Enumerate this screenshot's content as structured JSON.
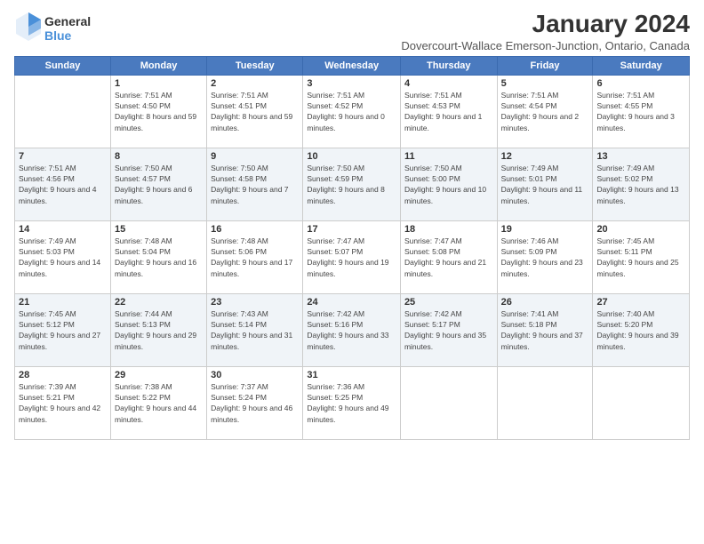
{
  "logo": {
    "text_general": "General",
    "text_blue": "Blue"
  },
  "title": "January 2024",
  "subtitle": "Dovercourt-Wallace Emerson-Junction, Ontario, Canada",
  "days_of_week": [
    "Sunday",
    "Monday",
    "Tuesday",
    "Wednesday",
    "Thursday",
    "Friday",
    "Saturday"
  ],
  "weeks": [
    [
      {
        "day": "",
        "sunrise": "",
        "sunset": "",
        "daylight": ""
      },
      {
        "day": "1",
        "sunrise": "Sunrise: 7:51 AM",
        "sunset": "Sunset: 4:50 PM",
        "daylight": "Daylight: 8 hours and 59 minutes."
      },
      {
        "day": "2",
        "sunrise": "Sunrise: 7:51 AM",
        "sunset": "Sunset: 4:51 PM",
        "daylight": "Daylight: 8 hours and 59 minutes."
      },
      {
        "day": "3",
        "sunrise": "Sunrise: 7:51 AM",
        "sunset": "Sunset: 4:52 PM",
        "daylight": "Daylight: 9 hours and 0 minutes."
      },
      {
        "day": "4",
        "sunrise": "Sunrise: 7:51 AM",
        "sunset": "Sunset: 4:53 PM",
        "daylight": "Daylight: 9 hours and 1 minute."
      },
      {
        "day": "5",
        "sunrise": "Sunrise: 7:51 AM",
        "sunset": "Sunset: 4:54 PM",
        "daylight": "Daylight: 9 hours and 2 minutes."
      },
      {
        "day": "6",
        "sunrise": "Sunrise: 7:51 AM",
        "sunset": "Sunset: 4:55 PM",
        "daylight": "Daylight: 9 hours and 3 minutes."
      }
    ],
    [
      {
        "day": "7",
        "sunrise": "Sunrise: 7:51 AM",
        "sunset": "Sunset: 4:56 PM",
        "daylight": "Daylight: 9 hours and 4 minutes."
      },
      {
        "day": "8",
        "sunrise": "Sunrise: 7:50 AM",
        "sunset": "Sunset: 4:57 PM",
        "daylight": "Daylight: 9 hours and 6 minutes."
      },
      {
        "day": "9",
        "sunrise": "Sunrise: 7:50 AM",
        "sunset": "Sunset: 4:58 PM",
        "daylight": "Daylight: 9 hours and 7 minutes."
      },
      {
        "day": "10",
        "sunrise": "Sunrise: 7:50 AM",
        "sunset": "Sunset: 4:59 PM",
        "daylight": "Daylight: 9 hours and 8 minutes."
      },
      {
        "day": "11",
        "sunrise": "Sunrise: 7:50 AM",
        "sunset": "Sunset: 5:00 PM",
        "daylight": "Daylight: 9 hours and 10 minutes."
      },
      {
        "day": "12",
        "sunrise": "Sunrise: 7:49 AM",
        "sunset": "Sunset: 5:01 PM",
        "daylight": "Daylight: 9 hours and 11 minutes."
      },
      {
        "day": "13",
        "sunrise": "Sunrise: 7:49 AM",
        "sunset": "Sunset: 5:02 PM",
        "daylight": "Daylight: 9 hours and 13 minutes."
      }
    ],
    [
      {
        "day": "14",
        "sunrise": "Sunrise: 7:49 AM",
        "sunset": "Sunset: 5:03 PM",
        "daylight": "Daylight: 9 hours and 14 minutes."
      },
      {
        "day": "15",
        "sunrise": "Sunrise: 7:48 AM",
        "sunset": "Sunset: 5:04 PM",
        "daylight": "Daylight: 9 hours and 16 minutes."
      },
      {
        "day": "16",
        "sunrise": "Sunrise: 7:48 AM",
        "sunset": "Sunset: 5:06 PM",
        "daylight": "Daylight: 9 hours and 17 minutes."
      },
      {
        "day": "17",
        "sunrise": "Sunrise: 7:47 AM",
        "sunset": "Sunset: 5:07 PM",
        "daylight": "Daylight: 9 hours and 19 minutes."
      },
      {
        "day": "18",
        "sunrise": "Sunrise: 7:47 AM",
        "sunset": "Sunset: 5:08 PM",
        "daylight": "Daylight: 9 hours and 21 minutes."
      },
      {
        "day": "19",
        "sunrise": "Sunrise: 7:46 AM",
        "sunset": "Sunset: 5:09 PM",
        "daylight": "Daylight: 9 hours and 23 minutes."
      },
      {
        "day": "20",
        "sunrise": "Sunrise: 7:45 AM",
        "sunset": "Sunset: 5:11 PM",
        "daylight": "Daylight: 9 hours and 25 minutes."
      }
    ],
    [
      {
        "day": "21",
        "sunrise": "Sunrise: 7:45 AM",
        "sunset": "Sunset: 5:12 PM",
        "daylight": "Daylight: 9 hours and 27 minutes."
      },
      {
        "day": "22",
        "sunrise": "Sunrise: 7:44 AM",
        "sunset": "Sunset: 5:13 PM",
        "daylight": "Daylight: 9 hours and 29 minutes."
      },
      {
        "day": "23",
        "sunrise": "Sunrise: 7:43 AM",
        "sunset": "Sunset: 5:14 PM",
        "daylight": "Daylight: 9 hours and 31 minutes."
      },
      {
        "day": "24",
        "sunrise": "Sunrise: 7:42 AM",
        "sunset": "Sunset: 5:16 PM",
        "daylight": "Daylight: 9 hours and 33 minutes."
      },
      {
        "day": "25",
        "sunrise": "Sunrise: 7:42 AM",
        "sunset": "Sunset: 5:17 PM",
        "daylight": "Daylight: 9 hours and 35 minutes."
      },
      {
        "day": "26",
        "sunrise": "Sunrise: 7:41 AM",
        "sunset": "Sunset: 5:18 PM",
        "daylight": "Daylight: 9 hours and 37 minutes."
      },
      {
        "day": "27",
        "sunrise": "Sunrise: 7:40 AM",
        "sunset": "Sunset: 5:20 PM",
        "daylight": "Daylight: 9 hours and 39 minutes."
      }
    ],
    [
      {
        "day": "28",
        "sunrise": "Sunrise: 7:39 AM",
        "sunset": "Sunset: 5:21 PM",
        "daylight": "Daylight: 9 hours and 42 minutes."
      },
      {
        "day": "29",
        "sunrise": "Sunrise: 7:38 AM",
        "sunset": "Sunset: 5:22 PM",
        "daylight": "Daylight: 9 hours and 44 minutes."
      },
      {
        "day": "30",
        "sunrise": "Sunrise: 7:37 AM",
        "sunset": "Sunset: 5:24 PM",
        "daylight": "Daylight: 9 hours and 46 minutes."
      },
      {
        "day": "31",
        "sunrise": "Sunrise: 7:36 AM",
        "sunset": "Sunset: 5:25 PM",
        "daylight": "Daylight: 9 hours and 49 minutes."
      },
      {
        "day": "",
        "sunrise": "",
        "sunset": "",
        "daylight": ""
      },
      {
        "day": "",
        "sunrise": "",
        "sunset": "",
        "daylight": ""
      },
      {
        "day": "",
        "sunrise": "",
        "sunset": "",
        "daylight": ""
      }
    ]
  ]
}
